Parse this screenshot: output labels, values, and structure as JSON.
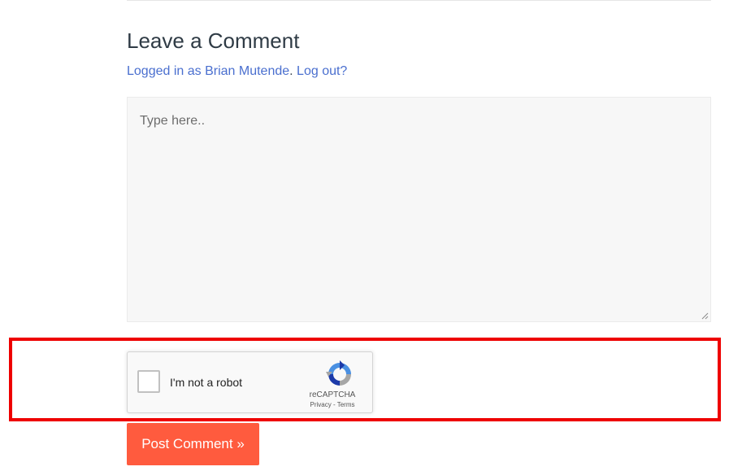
{
  "section": {
    "title": "Leave a Comment",
    "logged_in_prefix": "Logged in as ",
    "user_name": "Brian Mutende",
    "separator": ".",
    "logout_label": "Log out?"
  },
  "comment_form": {
    "placeholder": "Type here..",
    "value": ""
  },
  "captcha": {
    "label": "I'm not a robot",
    "brand": "reCAPTCHA",
    "privacy_label": "Privacy",
    "link_separator": " - ",
    "terms_label": "Terms",
    "checked": false,
    "logo_icon": "recaptcha-logo-icon"
  },
  "submit": {
    "label": "Post Comment »"
  },
  "colors": {
    "accent": "#ff5b3e",
    "link": "#4a6fcf",
    "highlight": "#ee0000"
  }
}
